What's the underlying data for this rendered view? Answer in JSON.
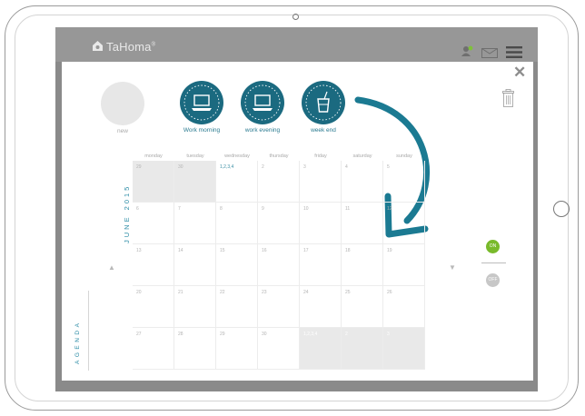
{
  "app": {
    "title": "TaHoma",
    "title_mark": "®"
  },
  "header_icons": [
    "user-icon",
    "mail-icon",
    "menu-icon"
  ],
  "scenarios": [
    {
      "label": "new",
      "icon": "new-scenario-placeholder"
    },
    {
      "label": "Work morning",
      "icon": "laptop-icon"
    },
    {
      "label": "work evening",
      "icon": "laptop-icon"
    },
    {
      "label": "week end",
      "icon": "drink-icon"
    }
  ],
  "calendar": {
    "month_label": "JUNE 2015",
    "days": [
      "monday",
      "tuesday",
      "wednesday",
      "thursday",
      "friday",
      "saturday",
      "sunday"
    ],
    "weeks": [
      [
        "29",
        "30",
        "1,2,3,4",
        "2",
        "3",
        "4",
        "5"
      ],
      [
        "6",
        "7",
        "8",
        "9",
        "10",
        "11",
        "12"
      ],
      [
        "13",
        "14",
        "15",
        "16",
        "17",
        "18",
        "19"
      ],
      [
        "20",
        "21",
        "22",
        "23",
        "24",
        "25",
        "26"
      ],
      [
        "27",
        "28",
        "29",
        "30",
        "1,2,3,4",
        "2",
        "3"
      ]
    ]
  },
  "side_label": "AGENDA",
  "toggles": {
    "on": "ON",
    "off": "OFF"
  },
  "colors": {
    "teal": "#1b6a80",
    "green": "#79ba2b",
    "grey_cell": "#e9e9e9"
  }
}
